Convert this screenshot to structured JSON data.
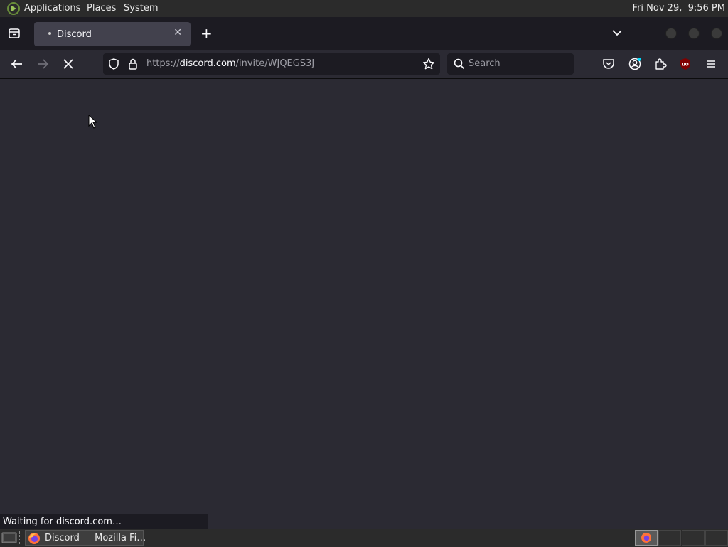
{
  "top_panel": {
    "menus": [
      "Applications",
      "Places",
      "System"
    ],
    "clock": "Fri Nov 29,  9:56 PM"
  },
  "browser": {
    "tab": {
      "title": "Discord",
      "close_glyph": "✕"
    },
    "new_tab_glyph": "+",
    "url": {
      "scheme": "https://",
      "host": "discord.com",
      "path": "/invite/WJQEGS3J"
    },
    "search": {
      "placeholder": "Search"
    },
    "status_text": "Waiting for discord.com…"
  },
  "taskbar": {
    "window_button_label": "Discord — Mozilla Fi…"
  },
  "icons": {
    "app_menu": "gnome-foot-icon",
    "tabs_list": "tab-list-icon",
    "back": "arrow-left-icon",
    "forward": "arrow-right-icon",
    "stop": "close-x-icon",
    "shield": "tracking-shield-icon",
    "lock": "lock-icon",
    "bookmark": "star-icon",
    "pocket": "pocket-icon",
    "account": "account-icon",
    "extensions": "puzzle-icon",
    "ublock": "ublock-origin-icon",
    "menu": "hamburger-icon"
  },
  "colors": {
    "chrome_bg": "#2b2a33",
    "tabstrip_bg": "#1c1b22",
    "field_bg": "#1c1b22",
    "accent_blue": "#00ddff",
    "ublock_red": "#800000"
  }
}
